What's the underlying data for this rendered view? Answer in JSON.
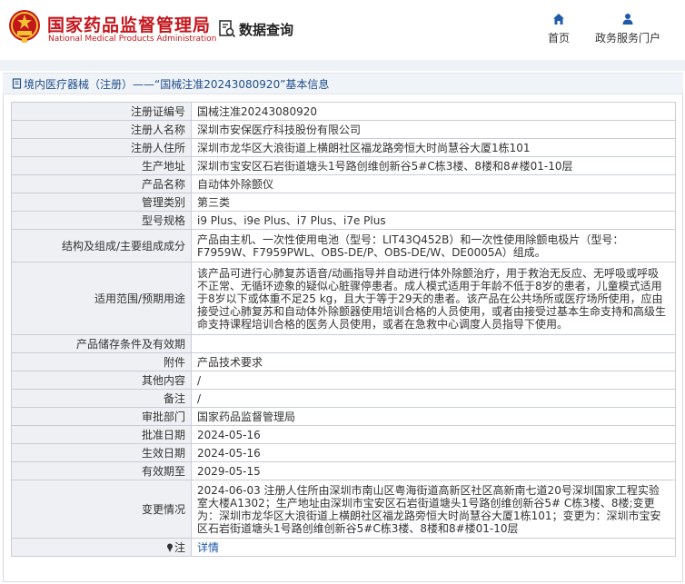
{
  "header": {
    "org_cn": "国家药品监督管理局",
    "org_en": "National Medical Products Administration",
    "data_query": "数据查询",
    "nav": [
      {
        "label": "首页",
        "icon": "home-icon"
      },
      {
        "label": "政务服务门户",
        "icon": "user-icon"
      }
    ]
  },
  "breadcrumb": "境内医疗器械（注册）——“国械注准20243080920”基本信息",
  "colors": {
    "brand_red": "#c3161c",
    "link_blue": "#1e5aa8",
    "label_bg": "#eef0f3"
  },
  "rows": [
    {
      "label": "注册证编号",
      "value": "国械注准20243080920"
    },
    {
      "label": "注册人名称",
      "value": "深圳市安保医疗科技股份有限公司"
    },
    {
      "label": "注册人住所",
      "value": "深圳市龙华区大浪街道上横朗社区福龙路旁恒大时尚慧谷大厦1栋101"
    },
    {
      "label": "生产地址",
      "value": "深圳市宝安区石岩街道塘头1号路创维创新谷5#C栋3楼、8楼和8#楼01-10层"
    },
    {
      "label": "产品名称",
      "value": "自动体外除颤仪"
    },
    {
      "label": "管理类别",
      "value": "第三类"
    },
    {
      "label": "型号规格",
      "value": "i9 Plus、i9e Plus、i7 Plus、i7e Plus"
    },
    {
      "label": "结构及组成/主要组成成分",
      "value": "产品由主机、一次性使用电池（型号：LIT43Q452B）和一次性使用除颤电极片（型号：F7959W、F7959PWL、OBS-DE/P、OBS-DE/W、DE0005A）组成。"
    },
    {
      "label": "适用范围/预期用途",
      "value": "该产品可进行心肺复苏语音/动画指导并自动进行体外除颤治疗，用于救治无反应、无呼吸或呼吸不正常、无循环迹象的疑似心脏骤停患者。成人模式适用于年龄不低于8岁的患者，儿童模式适用于8岁以下或体重不足25 kg，且大于等于29天的患者。该产品在公共场所或医疗场所使用，应由接受过心肺复苏和自动体外除颤器使用培训合格的人员使用，或者由接受过基本生命支持和高级生命支持课程培训合格的医务人员使用，或者在急救中心调度人员指导下使用。"
    },
    {
      "label": "产品储存条件及有效期",
      "value": ""
    },
    {
      "label": "附件",
      "value": "产品技术要求"
    },
    {
      "label": "其他内容",
      "value": "/"
    },
    {
      "label": "备注",
      "value": "/"
    },
    {
      "label": "审批部门",
      "value": "国家药品监督管理局"
    },
    {
      "label": "批准日期",
      "value": "2024-05-16"
    },
    {
      "label": "生效日期",
      "value": "2024-05-16"
    },
    {
      "label": "有效期至",
      "value": "2029-05-15"
    },
    {
      "label": "变更情况",
      "value": "2024-06-03 注册人住所由深圳市南山区粤海街道高新区社区高新南七道20号深圳国家工程实验室大楼A1302；生产地址由深圳市宝安区石岩街道塘头1号路创维创新谷5# C栋3楼、8楼;变更为：深圳市龙华区大浪街道上横朗社区福龙路旁恒大时尚慧谷大厦1栋101；变更为：深圳市宝安区石岩街道塘头1号路创维创新谷5#C栋3楼、8楼和8#楼01-10层"
    },
    {
      "label": "注",
      "value": "详情"
    }
  ]
}
